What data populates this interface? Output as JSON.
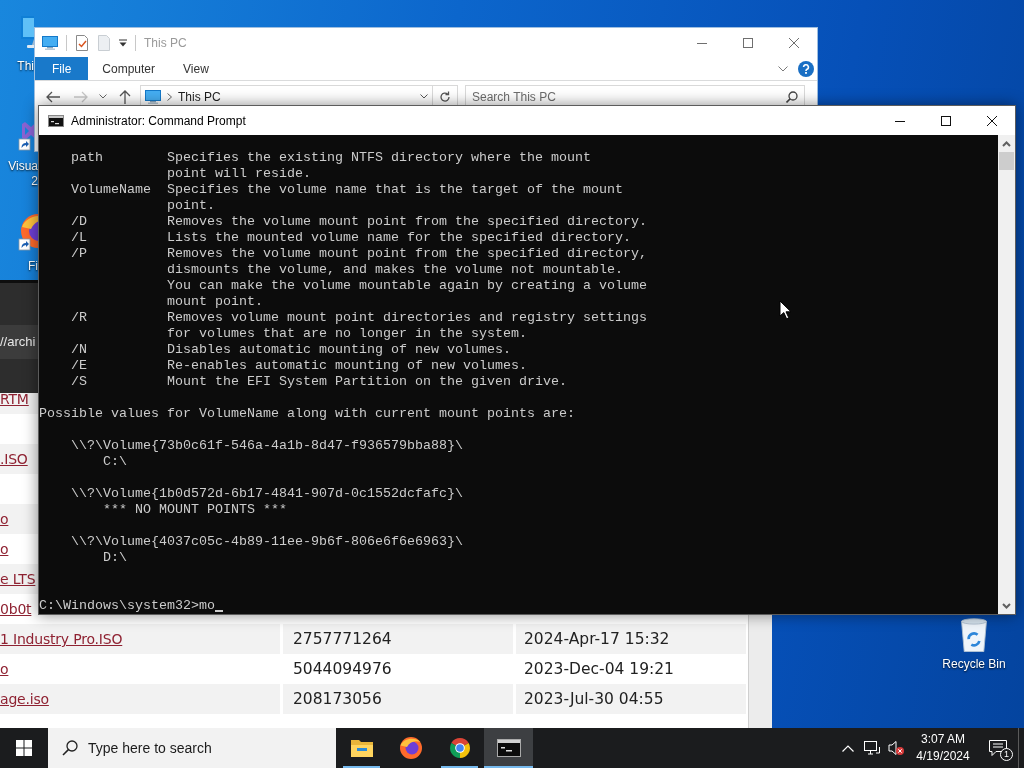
{
  "desktop": {
    "icons": [
      {
        "kind": "computer",
        "label": [
          "Thi"
        ]
      },
      {
        "kind": "studio",
        "label": [
          "Visua",
          "2"
        ]
      },
      {
        "kind": "fox",
        "label": [
          "Fi"
        ]
      }
    ],
    "recycle_bin": {
      "label": "Recycle Bin"
    }
  },
  "explorer": {
    "title": "This PC",
    "ribbon_tabs": [
      {
        "label": "File",
        "selected": true
      },
      {
        "label": "Computer",
        "selected": false
      },
      {
        "label": "View",
        "selected": false
      }
    ],
    "address": "This PC",
    "search": {
      "placeholder": "Search This PC"
    }
  },
  "console": {
    "title": "Administrator: Command Prompt",
    "options": [
      {
        "flag": "path",
        "description": [
          "Specifies the existing NTFS directory where the mount",
          "point will reside."
        ]
      },
      {
        "flag": "VolumeName",
        "description": [
          "Specifies the volume name that is the target of the mount",
          "point."
        ]
      },
      {
        "flag": "/D",
        "description": [
          "Removes the volume mount point from the specified directory."
        ]
      },
      {
        "flag": "/L",
        "description": [
          "Lists the mounted volume name for the specified directory."
        ]
      },
      {
        "flag": "/P",
        "description": [
          "Removes the volume mount point from the specified directory,",
          "dismounts the volume, and makes the volume not mountable.",
          "You can make the volume mountable again by creating a volume",
          "mount point."
        ]
      },
      {
        "flag": "/R",
        "description": [
          "Removes volume mount point directories and registry settings",
          "for volumes that are no longer in the system."
        ]
      },
      {
        "flag": "/N",
        "description": [
          "Disables automatic mounting of new volumes."
        ]
      },
      {
        "flag": "/E",
        "description": [
          "Re-enables automatic mounting of new volumes."
        ]
      },
      {
        "flag": "/S",
        "description": [
          "Mount the EFI System Partition on the given drive."
        ]
      }
    ],
    "heading": "Possible values for VolumeName along with current mount points are:",
    "volumes": [
      {
        "path": "\\\\?\\Volume{73b0c61f-546a-4a1b-8d47-f936579bba88}\\",
        "mount": "C:\\"
      },
      {
        "path": "\\\\?\\Volume{1b0d572d-6b17-4841-907d-0c1552dcfafc}\\",
        "mount": "*** NO MOUNT POINTS ***"
      },
      {
        "path": "\\\\?\\Volume{4037c05c-4b89-11ee-9b6f-806e6f6e6963}\\",
        "mount": "D:\\"
      }
    ],
    "prompt": "C:\\Windows\\system32>mo"
  },
  "browser": {
    "address": "//archi",
    "rows": [
      {
        "name": "RTM"
      },
      {},
      {
        "name": ".ISO"
      },
      {},
      {
        "name": "o"
      },
      {
        "name": "o"
      },
      {
        "name": "e LTS"
      },
      {
        "name": "0b0t"
      },
      {
        "name": "1 Industry Pro.ISO",
        "size": "2757771264",
        "date": "2024-Apr-17 15:32"
      },
      {
        "name": "o",
        "size": "5044094976",
        "date": "2023-Dec-04 19:21"
      },
      {
        "name": "age.iso",
        "size": "208173056",
        "date": "2023-Jul-30 04:55"
      }
    ]
  },
  "taskbar": {
    "search": {
      "placeholder": "Type here to search"
    },
    "apps": [
      {
        "kind": "folder",
        "running": true,
        "selected": false
      },
      {
        "kind": "fox",
        "running": false,
        "selected": false
      },
      {
        "kind": "ring",
        "running": true,
        "selected": false
      },
      {
        "kind": "console",
        "running": true,
        "selected": true
      }
    ],
    "clock": {
      "time": "3:07 AM",
      "date": "4/19/2024"
    },
    "notifications": {
      "count": "1"
    }
  }
}
